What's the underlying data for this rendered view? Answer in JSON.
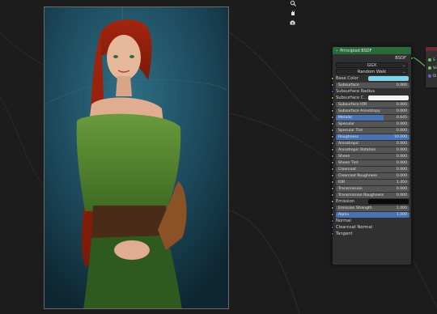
{
  "node": {
    "title": "Principled BSDF",
    "output": "BSDF",
    "distribution": "GGX",
    "subsurface_method": "Random Walk",
    "inputs": {
      "base_color": "Base Color",
      "subsurface": {
        "label": "Subsurface",
        "value": "0.000"
      },
      "subsurface_radius": "Subsurface Radius",
      "subsurface_color": "Subsurface C...",
      "subsurface_ior": {
        "label": "Subsurface IOR",
        "value": "0.000"
      },
      "subsurface_anisotropy": {
        "label": "Subsurface Anisotropy",
        "value": "0.000"
      },
      "metallic": {
        "label": "Metallic",
        "value": "0.645",
        "fill": 0.645
      },
      "specular": {
        "label": "Specular",
        "value": "0.000"
      },
      "specular_tint": {
        "label": "Specular Tint",
        "value": "0.000"
      },
      "roughness": {
        "label": "Roughness",
        "value": "10.000",
        "fill": 1.0
      },
      "anisotropic": {
        "label": "Anisotropic",
        "value": "0.000"
      },
      "anisotropic_rotation": {
        "label": "Anisotropic Rotation",
        "value": "0.000"
      },
      "sheen": {
        "label": "Sheen",
        "value": "0.000"
      },
      "sheen_tint": {
        "label": "Sheen Tint",
        "value": "0.000"
      },
      "clearcoat": {
        "label": "Clearcoat",
        "value": "0.000"
      },
      "clearcoat_roughness": {
        "label": "Clearcoat Roughness",
        "value": "0.000"
      },
      "ior": {
        "label": "IOR",
        "value": "1.450"
      },
      "transmission": {
        "label": "Transmission",
        "value": "0.000"
      },
      "transmission_roughness": {
        "label": "Transmission Roughness",
        "value": "0.000"
      },
      "emission": "Emission",
      "emission_strength": {
        "label": "Emission Strength",
        "value": "1.000"
      },
      "alpha": {
        "label": "Alpha",
        "value": "1.000",
        "fill": 1.0
      },
      "normal": "Normal",
      "clearcoat_normal": "Clearcoat Normal",
      "tangent": "Tangent"
    }
  },
  "right_node": {
    "labels": [
      "S",
      "Vo",
      "Di"
    ]
  },
  "colors": {
    "node_header": "#2a6a3a",
    "base_color_swatch": "#7fd4ec",
    "subsurface_swatch": "#f2f2f2",
    "emission_swatch": "#0a0a0a",
    "field_fill": "#4772b3",
    "socket_yellow": "#c7c729",
    "socket_gray": "#a1a1a1",
    "socket_blue": "#6363c7",
    "socket_green": "#63c763"
  },
  "view_tools": [
    "zoom-icon",
    "hand-icon",
    "camera-icon"
  ]
}
